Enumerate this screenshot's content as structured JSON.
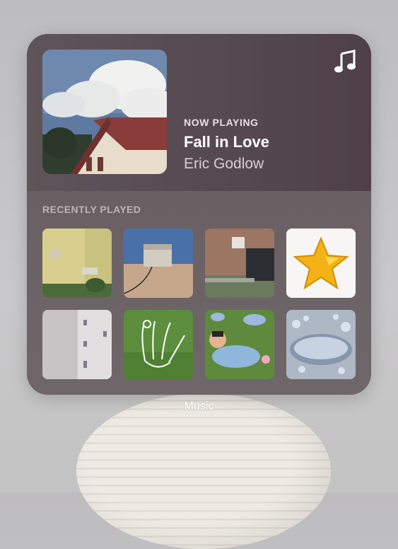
{
  "widget": {
    "now_playing_label": "NOW PLAYING",
    "song_title": "Fall in Love",
    "artist": "Eric Godlow",
    "recently_played_label": "RECENTLY PLAYED",
    "app_icon": "music-note-icon",
    "recent_items": [
      "building-photo",
      "amp-photo",
      "brick-wall-car-photo",
      "gold-star-art",
      "white-building-photo",
      "grass-hand-doodle",
      "lying-person-art",
      "balloon-lettering-art"
    ]
  },
  "app_caption": "Music",
  "colors": {
    "widget_bg": "#5a4e55",
    "text_primary": "#ffffff",
    "text_secondary": "#d8cfd3"
  }
}
